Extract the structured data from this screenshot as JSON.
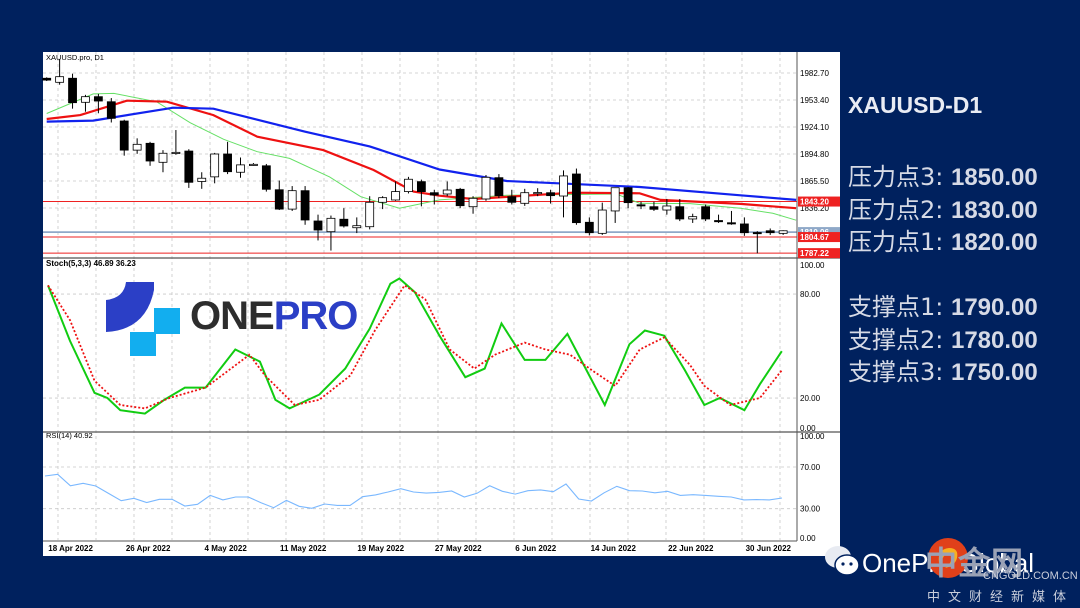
{
  "side_panel": {
    "title": "XAUUSD-D1",
    "resistance": [
      {
        "label": "压力点3: ",
        "value": "1850.00"
      },
      {
        "label": "压力点2: ",
        "value": "1830.00"
      },
      {
        "label": "压力点1: ",
        "value": "1820.00"
      }
    ],
    "support": [
      {
        "label": "支撑点1: ",
        "value": "1790.00"
      },
      {
        "label": "支撑点2: ",
        "value": "1780.00"
      },
      {
        "label": "支撑点3: ",
        "value": "1750.00"
      }
    ]
  },
  "logo": {
    "text_dark": "ONE",
    "text_blue": "PRO"
  },
  "watermark": {
    "brand": "OnePro Global",
    "site_cn": "中金网",
    "site_url": "CNGOLD.COM.CN",
    "tagline": "中文财经新媒体"
  },
  "colors": {
    "background": "#00215e",
    "ma_fast": "#66e066",
    "ma_mid": "#ee1111",
    "ma_slow": "#1122ee",
    "stoch_k": "#11cc11",
    "stoch_d": "#ee1111",
    "rsi": "#7ab8ff",
    "level_red": "#ee2222",
    "level_grey": "#8fa8c8"
  },
  "chart_data": [
    {
      "type": "candlestick",
      "title": "XAUUSD.pro, D1",
      "ylim": [
        1780,
        2005
      ],
      "yticks": [
        "1982.70",
        "1953.40",
        "1924.10",
        "1894.80",
        "1865.50",
        "1836.20"
      ],
      "xticks": [
        "18 Apr 2022",
        "26 Apr 2022",
        "4 May 2022",
        "11 May 2022",
        "19 May 2022",
        "27 May 2022",
        "6 Jun 2022",
        "14 Jun 2022",
        "22 Jun 2022",
        "30 Jun 2022"
      ],
      "xtick_index": [
        1.0,
        7.0,
        13.0,
        19.0,
        25.0,
        31.0,
        37.0,
        43.0,
        49.0,
        55.0
      ],
      "ohlc": [
        [
          1977,
          1978,
          1974,
          1975
        ],
        [
          1972.6,
          1998,
          1970,
          1978.7
        ],
        [
          1977,
          1982,
          1944,
          1950.5
        ],
        [
          1950.9,
          1959,
          1940.7,
          1957
        ],
        [
          1957,
          1960,
          1939,
          1952.3
        ],
        [
          1951.5,
          1955.5,
          1929,
          1933.5
        ],
        [
          1930.6,
          1932,
          1893,
          1899
        ],
        [
          1899,
          1911.8,
          1895,
          1905.3
        ],
        [
          1906.4,
          1908,
          1882,
          1887.2
        ],
        [
          1885.8,
          1899,
          1875,
          1895.6
        ],
        [
          1896,
          1920.8,
          1894,
          1896.6
        ],
        [
          1898,
          1900,
          1858,
          1864.1
        ],
        [
          1865,
          1875,
          1857,
          1868.5
        ],
        [
          1870,
          1896,
          1863,
          1894.8
        ],
        [
          1894.8,
          1908,
          1873,
          1875.6
        ],
        [
          1875,
          1891,
          1869,
          1883
        ],
        [
          1883.3,
          1885,
          1882,
          1883.6
        ],
        [
          1882,
          1884,
          1854,
          1856.5
        ],
        [
          1856,
          1866,
          1834,
          1835
        ],
        [
          1835,
          1860,
          1833,
          1855
        ],
        [
          1855,
          1860,
          1818,
          1823.2
        ],
        [
          1822.1,
          1829,
          1801,
          1812.3
        ],
        [
          1810.5,
          1828,
          1790,
          1825
        ],
        [
          1824,
          1836,
          1815,
          1816.7
        ],
        [
          1814.8,
          1826,
          1809,
          1817
        ],
        [
          1815.9,
          1849,
          1813,
          1842.4
        ],
        [
          1842.4,
          1849,
          1835,
          1847.4
        ],
        [
          1844.9,
          1865,
          1844,
          1854
        ],
        [
          1854,
          1870,
          1852,
          1867.4
        ],
        [
          1864.8,
          1867,
          1838,
          1854
        ],
        [
          1852.8,
          1856,
          1840,
          1850.3
        ],
        [
          1851.4,
          1865,
          1849,
          1855.7
        ],
        [
          1856.5,
          1858,
          1836,
          1838.7
        ],
        [
          1837.6,
          1849,
          1830,
          1846.7
        ],
        [
          1846,
          1872,
          1844,
          1869.5
        ],
        [
          1869.1,
          1873,
          1847,
          1849.6
        ],
        [
          1848.5,
          1856,
          1840,
          1842.4
        ],
        [
          1841.3,
          1857,
          1838.5,
          1852.8
        ],
        [
          1852.6,
          1857.7,
          1849,
          1853
        ],
        [
          1852.8,
          1856,
          1841,
          1849.6
        ],
        [
          1849.2,
          1877,
          1826,
          1871
        ],
        [
          1873.1,
          1879,
          1818,
          1820.3
        ],
        [
          1820.7,
          1826,
          1806.5,
          1809.4
        ],
        [
          1808.7,
          1842,
          1807,
          1834
        ],
        [
          1833,
          1858.5,
          1820,
          1858.2
        ],
        [
          1858.2,
          1859,
          1836,
          1842
        ],
        [
          1839.7,
          1843,
          1835,
          1839.5
        ],
        [
          1837.6,
          1843,
          1833,
          1834.8
        ],
        [
          1834,
          1846,
          1829,
          1838.4
        ],
        [
          1837.6,
          1846,
          1822,
          1824.3
        ],
        [
          1824.3,
          1830,
          1820,
          1826.8
        ],
        [
          1837.6,
          1840,
          1822,
          1824.3
        ],
        [
          1822.6,
          1829,
          1820,
          1822.4
        ],
        [
          1820.2,
          1833,
          1818,
          1820
        ],
        [
          1818.9,
          1826,
          1806,
          1809.4
        ],
        [
          1809.6,
          1811,
          1787,
          1809.4
        ],
        [
          1811.5,
          1814,
          1807,
          1809.4
        ],
        [
          1808.7,
          1812,
          1807,
          1811.5
        ]
      ],
      "moving_averages": [
        {
          "name": "MA fast",
          "color": "#66e066",
          "points": [
            [
              0,
              1938.8
            ],
            [
              3.6,
              1960
            ],
            [
              5.2,
              1960.6
            ],
            [
              8.5,
              1951.6
            ],
            [
              11.1,
              1928.8
            ],
            [
              13.7,
              1910.7
            ],
            [
              16.3,
              1897.3
            ],
            [
              18.8,
              1890
            ],
            [
              21.9,
              1870
            ],
            [
              24.3,
              1848.5
            ],
            [
              27.3,
              1836
            ],
            [
              30.4,
              1845
            ],
            [
              35.6,
              1850
            ],
            [
              44.1,
              1851.4
            ],
            [
              45.9,
              1841.3
            ],
            [
              49.8,
              1841
            ],
            [
              53.7,
              1836
            ],
            [
              56.2,
              1830.5
            ],
            [
              58,
              1823
            ]
          ]
        },
        {
          "name": "MA mid",
          "color": "#ee1111",
          "points": [
            [
              0,
              1932.8
            ],
            [
              2.6,
              1937
            ],
            [
              6.2,
              1952.6
            ],
            [
              9.3,
              1951.6
            ],
            [
              12.9,
              1937
            ],
            [
              16.3,
              1913.6
            ],
            [
              21.4,
              1899
            ],
            [
              25.3,
              1877.4
            ],
            [
              28.4,
              1854
            ],
            [
              30.4,
              1849.6
            ],
            [
              33,
              1846
            ],
            [
              40.7,
              1852.8
            ],
            [
              45.9,
              1852.2
            ],
            [
              47.5,
              1845
            ],
            [
              53.7,
              1840.6
            ],
            [
              58,
              1836
            ]
          ]
        },
        {
          "name": "MA slow",
          "color": "#1122ee",
          "points": [
            [
              0,
              1930
            ],
            [
              3.6,
              1931
            ],
            [
              9.8,
              1945
            ],
            [
              12.9,
              1944
            ],
            [
              20,
              1919
            ],
            [
              25,
              1903
            ],
            [
              30.4,
              1878
            ],
            [
              35.6,
              1865.5
            ],
            [
              45.9,
              1859
            ],
            [
              53.7,
              1850
            ],
            [
              58,
              1845
            ]
          ]
        }
      ],
      "levels": [
        {
          "value": "1843.20",
          "color": "#ee2222"
        },
        {
          "value": "1810.06",
          "color": "#8fa8c8"
        },
        {
          "value": "1804.67",
          "color": "#ee2222"
        },
        {
          "value": "1787.22",
          "color": "#ee2222"
        }
      ]
    },
    {
      "type": "line",
      "title": "Stoch(5,3,3) 46.89 36.23",
      "ylim": [
        0,
        100
      ],
      "yticks": [
        "100.00",
        "80.00",
        "20.00",
        "0.00"
      ],
      "series": [
        {
          "name": "%K",
          "color": "#11cc11",
          "points": [
            [
              0.1,
              85
            ],
            [
              1.8,
              53
            ],
            [
              3.7,
              23
            ],
            [
              4.7,
              20
            ],
            [
              5.7,
              13
            ],
            [
              7.6,
              11
            ],
            [
              9.1,
              19
            ],
            [
              10.7,
              26
            ],
            [
              12.3,
              26
            ],
            [
              14.6,
              48
            ],
            [
              16.5,
              41
            ],
            [
              17.7,
              19
            ],
            [
              18.8,
              14
            ],
            [
              21.1,
              22
            ],
            [
              23.1,
              37
            ],
            [
              25,
              60
            ],
            [
              26.6,
              86
            ],
            [
              27.3,
              89
            ],
            [
              28.5,
              81
            ],
            [
              30.4,
              56
            ],
            [
              32.4,
              32
            ],
            [
              33.9,
              37
            ],
            [
              35.2,
              63
            ],
            [
              37,
              42
            ],
            [
              38.6,
              42
            ],
            [
              40.3,
              57
            ],
            [
              42,
              33
            ],
            [
              43.2,
              16
            ],
            [
              45.1,
              51
            ],
            [
              46.3,
              59
            ],
            [
              47.8,
              56
            ],
            [
              49.4,
              36
            ],
            [
              50.9,
              16
            ],
            [
              52.1,
              20
            ],
            [
              54,
              13
            ],
            [
              55.2,
              28
            ],
            [
              56.9,
              47
            ]
          ]
        },
        {
          "name": "%D",
          "color": "#ee1111",
          "points": [
            [
              0.1,
              85
            ],
            [
              1.8,
              65
            ],
            [
              3.7,
              30
            ],
            [
              5.7,
              16
            ],
            [
              7.6,
              14
            ],
            [
              9.5,
              20
            ],
            [
              12.3,
              26
            ],
            [
              15.7,
              45
            ],
            [
              16.9,
              33
            ],
            [
              19.2,
              16
            ],
            [
              21.1,
              19
            ],
            [
              23.5,
              33
            ],
            [
              25.4,
              59
            ],
            [
              27.7,
              85
            ],
            [
              29.3,
              77
            ],
            [
              31.2,
              48
            ],
            [
              33.1,
              37
            ],
            [
              34.7,
              45
            ],
            [
              37,
              52
            ],
            [
              38.6,
              48
            ],
            [
              40.5,
              45
            ],
            [
              42.4,
              35
            ],
            [
              44,
              27
            ],
            [
              45.9,
              48
            ],
            [
              47.8,
              55
            ],
            [
              49.8,
              39
            ],
            [
              50.9,
              27
            ],
            [
              52.9,
              16
            ],
            [
              55.2,
              20
            ],
            [
              56.9,
              36
            ]
          ]
        }
      ]
    },
    {
      "type": "line",
      "title": "RSI(14) 40.92",
      "ylim": [
        0,
        100
      ],
      "yticks": [
        "100.00",
        "70.00",
        "30.00",
        "0.00"
      ],
      "series": [
        {
          "name": "RSI",
          "color": "#7ab8ff",
          "values": [
            61.4,
            63,
            52,
            54.4,
            51.8,
            44.7,
            37.7,
            40,
            36,
            39,
            39,
            32.6,
            34.2,
            42.8,
            38.4,
            41.2,
            41.2,
            35.8,
            31,
            38,
            32.3,
            30.4,
            34.5,
            33.2,
            33.2,
            41.5,
            43.2,
            46,
            49.2,
            46,
            45,
            45.6,
            47,
            41.2,
            44.8,
            52,
            46.7,
            44,
            47.3,
            48,
            46.3,
            53.7,
            39.3,
            37.4,
            45.3,
            51.5,
            47.3,
            47,
            45.3,
            46.7,
            42.8,
            43.4,
            42.8,
            41.9,
            41.2,
            38.4,
            38.7,
            38.4,
            40.3
          ]
        }
      ]
    }
  ]
}
